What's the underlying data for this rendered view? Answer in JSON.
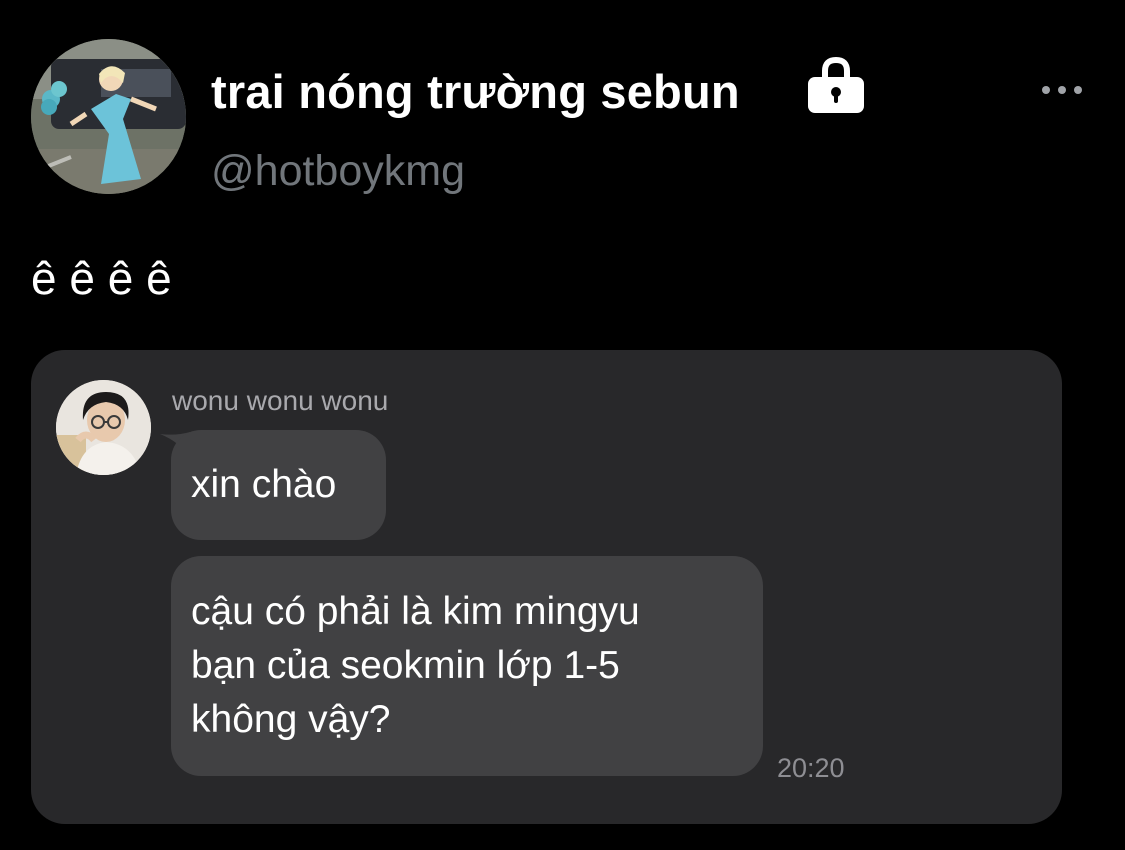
{
  "profile": {
    "display_name": "trai nóng trường sebun",
    "handle": "@hotboykmg",
    "avatar_icon": "elsa-costume-avatar",
    "protected_icon": "lock-icon"
  },
  "header": {
    "more_icon": "more-horizontal-icon"
  },
  "tweet": {
    "text": "ê ê ê ê"
  },
  "chat_screenshot": {
    "sender_name": "wonu wonu wonu",
    "sender_avatar_icon": "boy-with-glasses-avatar",
    "messages": [
      {
        "lines": [
          "xin chào"
        ]
      },
      {
        "lines": [
          "cậu có phải là kim mingyu",
          "bạn của seokmin lớp 1-5",
          "không vậy?"
        ]
      }
    ],
    "timestamp": "20:20"
  },
  "colors": {
    "background": "#000000",
    "handle_gray": "#71767b",
    "card_background": "#28282a",
    "bubble_background": "#414143"
  }
}
